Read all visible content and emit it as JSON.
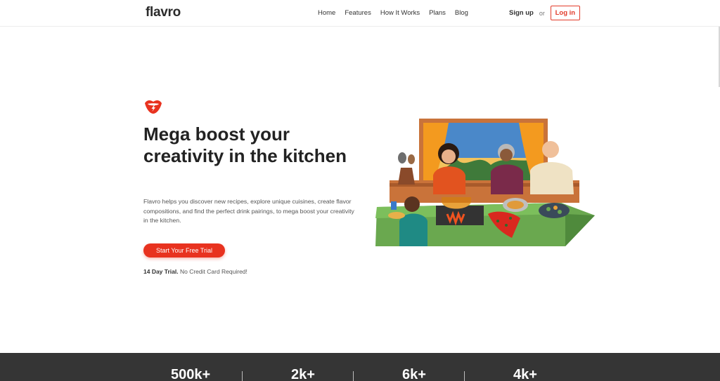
{
  "nav": {
    "logo": "flavro",
    "links": [
      "Home",
      "Features",
      "How It Works",
      "Plans",
      "Blog"
    ],
    "signup": "Sign up",
    "or": "or",
    "login": "Log in"
  },
  "hero": {
    "title": "Mega boost your creativity in the kitchen",
    "description": "Flavro helps you discover new recipes, explore unique cuisines, create flavor compositions, and find the perfect drink pairings, to mega boost your creativity in the kitchen.",
    "cta": "Start Your Free Trial",
    "trial_bold": "14 Day Trial.",
    "trial_rest": " No Credit Card Required!"
  },
  "stats": [
    "500k+",
    "2k+",
    "6k+",
    "4k+"
  ],
  "colors": {
    "accent": "#e8321f",
    "footer_bg": "#353535",
    "counter_green": "#6aa84f"
  },
  "icons": {
    "brand": "tongue-lips-icon"
  }
}
